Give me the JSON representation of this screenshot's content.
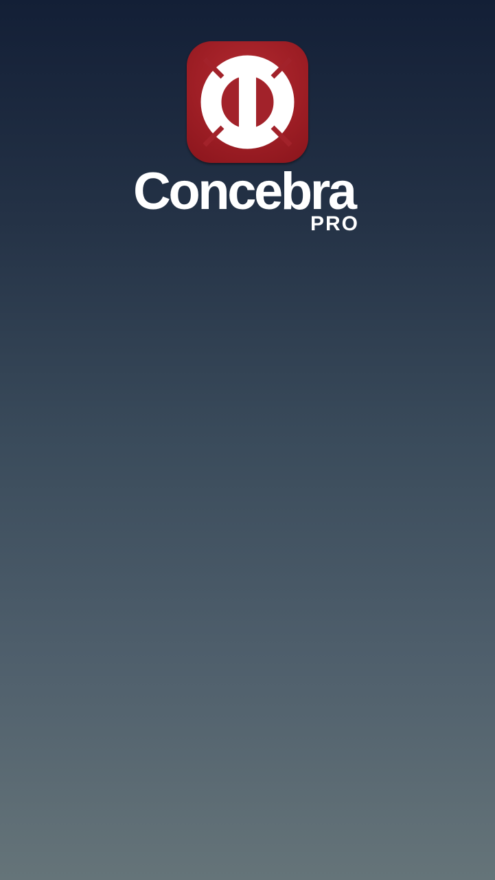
{
  "splash": {
    "icon": "lifebuoy-logo-icon",
    "brand_name": "Concebra",
    "brand_tier": "PRO"
  },
  "colors": {
    "icon_red": "#9e1e25",
    "background_top": "#131f36",
    "background_bottom": "#657479",
    "text": "#ffffff"
  }
}
